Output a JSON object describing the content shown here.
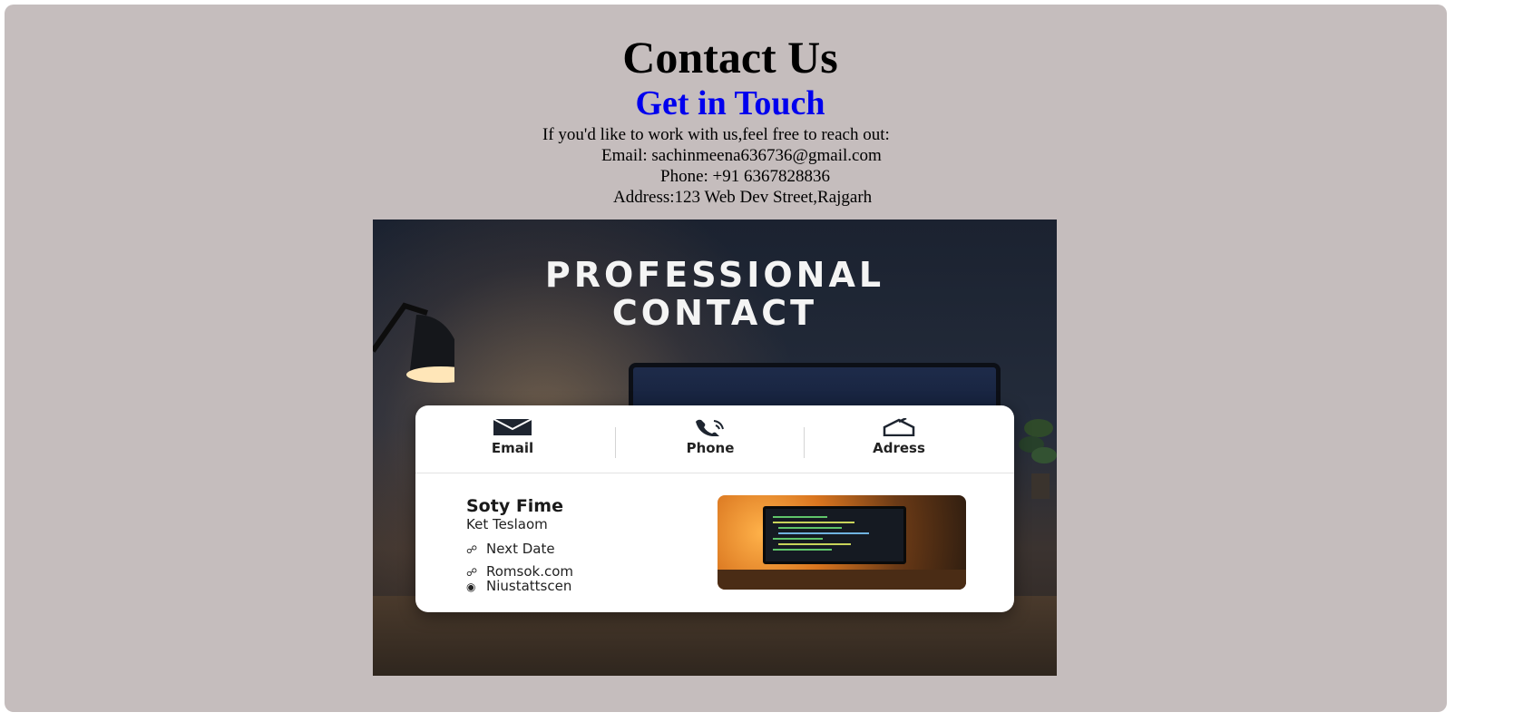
{
  "page": {
    "title": "Contact Us",
    "subtitle": "Get in Touch",
    "intro": "If you'd like to work with us,feel free to reach out:",
    "email_line": "Email: sachinmeena636736@gmail.com",
    "phone_line": "Phone: +91 6367828836",
    "address_line": "Address:123 Web Dev Street,Rajgarh"
  },
  "colors": {
    "panel_background": "#c5bdbd",
    "subtitle": "#0000ee"
  },
  "poster": {
    "title_line1": "PROFESSIONAL",
    "title_line2": "CONTACT",
    "tabs": [
      {
        "label": "Email",
        "icon": "envelope-icon"
      },
      {
        "label": "Phone",
        "icon": "phone-icon"
      },
      {
        "label": "Adress",
        "icon": "house-icon"
      }
    ],
    "card": {
      "name": "Soty Fime",
      "role": "Ket Teslaom",
      "lines": [
        {
          "icon": "link-icon",
          "text": "Next Date"
        },
        {
          "icon": "globe-icon",
          "text": "Romsok.com"
        },
        {
          "icon": "location-icon",
          "text": "Niustattscen"
        }
      ]
    }
  }
}
